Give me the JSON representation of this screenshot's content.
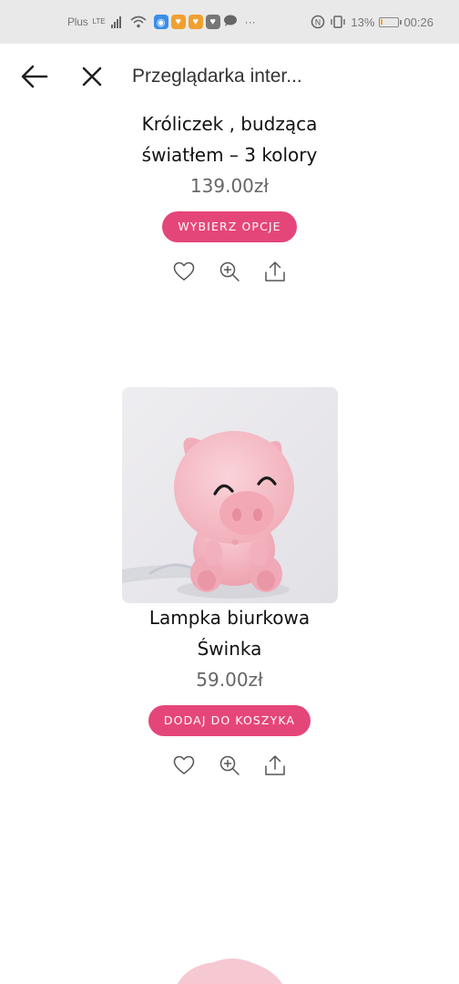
{
  "status_bar": {
    "carrier": "Plus",
    "network_type": "LTE",
    "battery_percent": "13%",
    "time": "00:26",
    "battery_level": 0.13
  },
  "browser": {
    "title": "Przeglądarka inter..."
  },
  "products": [
    {
      "name_line1": "Króliczek , budząca",
      "name_line2": "światłem – 3 kolory",
      "price": "139.00zł",
      "button_label": "WYBIERZ OPCJE"
    },
    {
      "name_line1": "Lampka biurkowa",
      "name_line2": "Świnka",
      "price": "59.00zł",
      "button_label": "DODAJ DO KOSZYKA"
    }
  ],
  "icons": {
    "wishlist": "heart-icon",
    "quick_view": "zoom-icon",
    "share": "share-icon"
  },
  "colors": {
    "accent": "#e5467a",
    "status_bar_bg": "#e9e9e9",
    "price": "#666666"
  }
}
